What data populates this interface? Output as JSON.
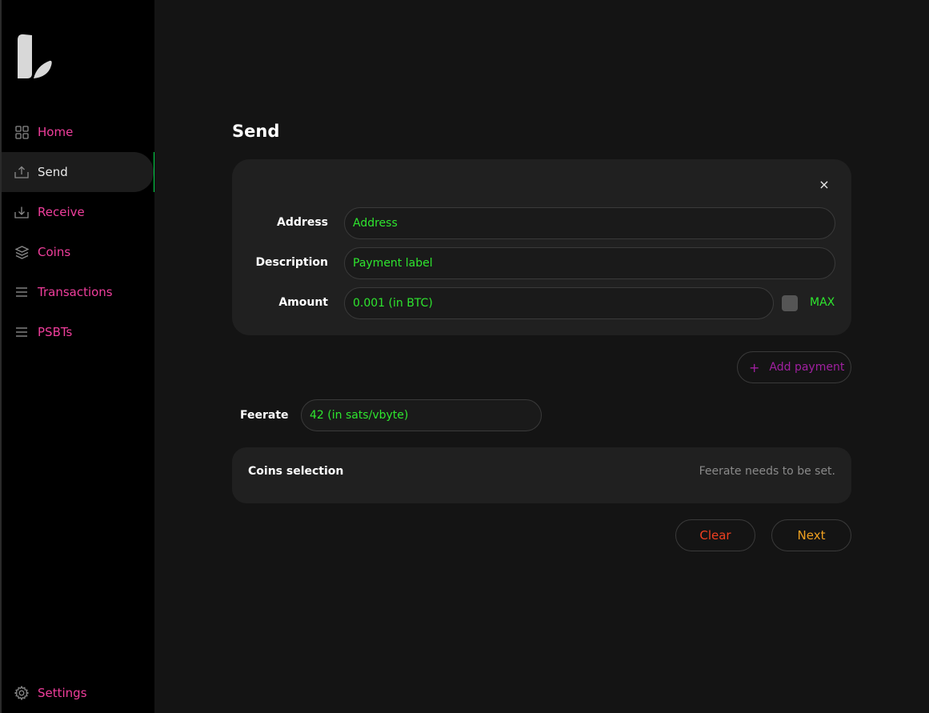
{
  "sidebar": {
    "items": [
      {
        "label": "Home",
        "icon": "grid-icon"
      },
      {
        "label": "Send",
        "icon": "upload-icon",
        "active": true
      },
      {
        "label": "Receive",
        "icon": "download-icon"
      },
      {
        "label": "Coins",
        "icon": "layers-icon"
      },
      {
        "label": "Transactions",
        "icon": "list-icon"
      },
      {
        "label": "PSBTs",
        "icon": "list-icon"
      }
    ],
    "settings": {
      "label": "Settings",
      "icon": "gear-icon"
    }
  },
  "main": {
    "title": "Send",
    "form": {
      "close": "×",
      "address_label": "Address",
      "address_placeholder": "Address",
      "description_label": "Description",
      "description_placeholder": "Payment label",
      "amount_label": "Amount",
      "amount_placeholder": "0.001 (in BTC)",
      "max_label": "MAX"
    },
    "add_payment": {
      "plus": "+",
      "label": "Add payment"
    },
    "feerate": {
      "label": "Feerate",
      "placeholder": "42 (in sats/vbyte)"
    },
    "coins_selection": {
      "title": "Coins selection",
      "note": "Feerate needs to be set."
    },
    "buttons": {
      "clear": "Clear",
      "next": "Next"
    }
  },
  "colors": {
    "accent_pink": "#f03e9c",
    "accent_green": "#2ee52e",
    "active_bar": "#00d84a",
    "clear_red": "#f04020",
    "next_orange": "#f0a020",
    "add_purple": "#a020a0"
  }
}
